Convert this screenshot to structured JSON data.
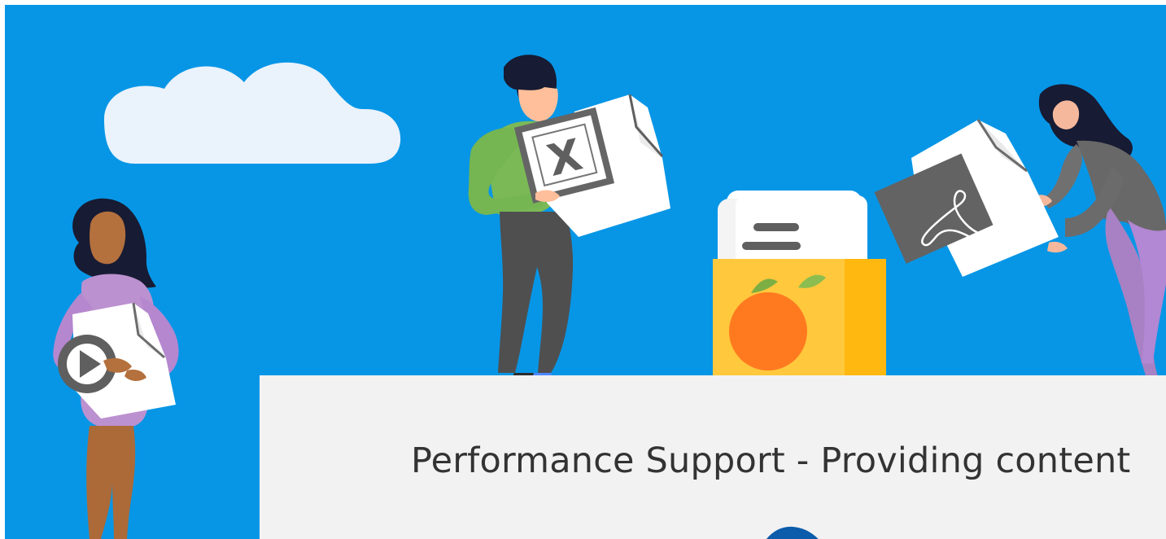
{
  "hero": {
    "background_color": "#0796e6"
  },
  "illustration": {
    "icons": {
      "excel": "excel-document-icon",
      "pdf": "pdf-document-icon",
      "video": "video-play-icon",
      "library": "file-box-icon",
      "fruit": "orange-fruit-icon"
    }
  },
  "content": {
    "title": "Performance Support - Providing content"
  },
  "colors": {
    "card_background": "#f2f2f2",
    "title_text": "#333333",
    "box_yellow": "#ffc83d",
    "orange": "#ff7a1f",
    "cloud": "#eaf2fb"
  }
}
